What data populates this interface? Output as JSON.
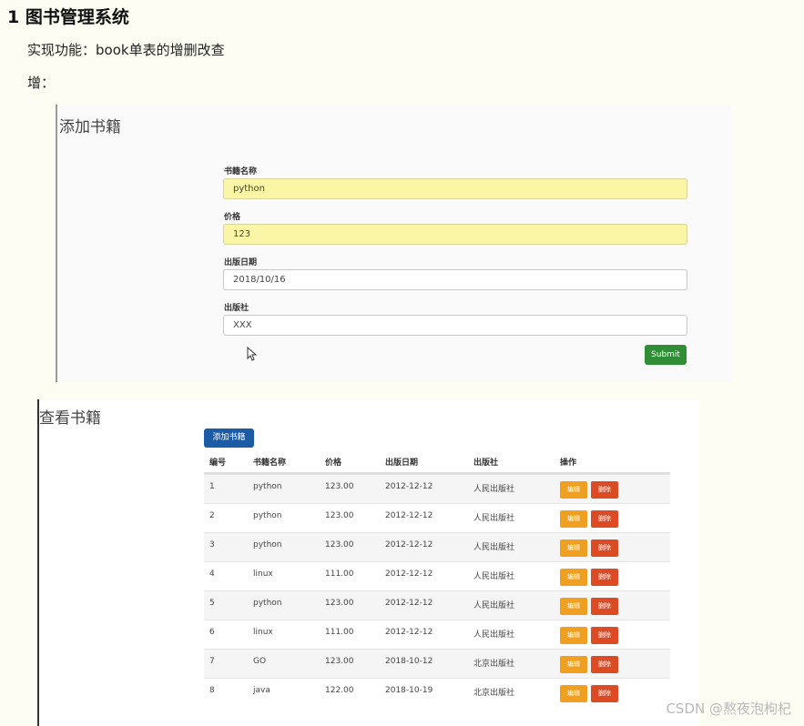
{
  "heading": "1 图书管理系统",
  "intro": "实现功能：book单表的增删改查",
  "add_label": "增：",
  "add_form": {
    "title": "添加书籍",
    "fields": [
      {
        "label": "书籍名称",
        "value": "python"
      },
      {
        "label": "价格",
        "value": "123"
      },
      {
        "label": "出版日期",
        "value": "2018/10/16"
      },
      {
        "label": "出版社",
        "value": "XXX"
      }
    ],
    "submit_label": "Submit"
  },
  "book_list": {
    "title": "查看书籍",
    "add_button": "添加书籍",
    "headers": [
      "编号",
      "书籍名称",
      "价格",
      "出版日期",
      "出版社",
      "操作"
    ],
    "rows": [
      {
        "id": "1",
        "name": "python",
        "price": "123.00",
        "date": "2012-12-12",
        "publisher": "人民出版社"
      },
      {
        "id": "2",
        "name": "python",
        "price": "123.00",
        "date": "2012-12-12",
        "publisher": "人民出版社"
      },
      {
        "id": "3",
        "name": "python",
        "price": "123.00",
        "date": "2012-12-12",
        "publisher": "人民出版社"
      },
      {
        "id": "4",
        "name": "linux",
        "price": "111.00",
        "date": "2012-12-12",
        "publisher": "人民出版社"
      },
      {
        "id": "5",
        "name": "python",
        "price": "123.00",
        "date": "2012-12-12",
        "publisher": "人民出版社"
      },
      {
        "id": "6",
        "name": "linux",
        "price": "111.00",
        "date": "2012-12-12",
        "publisher": "人民出版社"
      },
      {
        "id": "7",
        "name": "GO",
        "price": "123.00",
        "date": "2018-10-12",
        "publisher": "北京出版社"
      },
      {
        "id": "8",
        "name": "java",
        "price": "122.00",
        "date": "2018-10-19",
        "publisher": "北京出版社"
      }
    ],
    "edit_label": "编辑",
    "delete_label": "删除"
  },
  "watermark": "CSDN @熬夜泡枸杞"
}
